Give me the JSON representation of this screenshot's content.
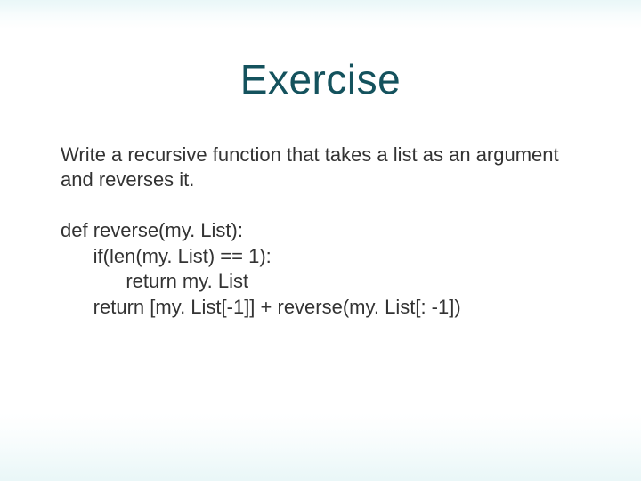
{
  "title": "Exercise",
  "prompt": "Write a recursive function that takes a list as an argument and reverses it.",
  "code": "def reverse(my. List):\n      if(len(my. List) == 1):\n            return my. List\n      return [my. List[-1]] + reverse(my. List[: -1])"
}
